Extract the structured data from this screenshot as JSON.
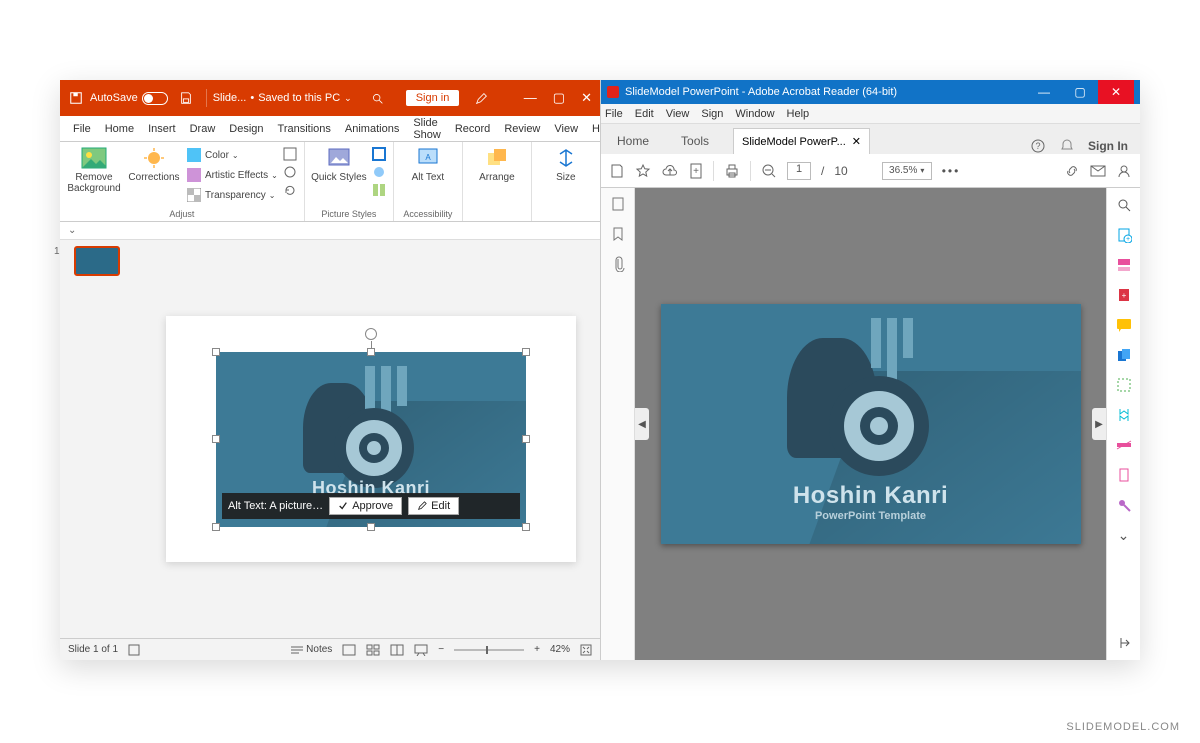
{
  "watermark": "SLIDEMODEL.COM",
  "powerpoint": {
    "titlebar": {
      "autosave_label": "AutoSave",
      "filename": "Slide...",
      "save_state": "Saved to this PC",
      "signin": "Sign in"
    },
    "tabs": [
      "File",
      "Home",
      "Insert",
      "Draw",
      "Design",
      "Transitions",
      "Animations",
      "Slide Show",
      "Record",
      "Review",
      "View",
      "Help"
    ],
    "ribbon": {
      "remove_bg": "Remove Background",
      "corrections": "Corrections",
      "color": "Color",
      "artistic": "Artistic Effects",
      "transparency": "Transparency",
      "adjust_label": "Adjust",
      "quick_styles": "Quick Styles",
      "picture_styles_label": "Picture Styles",
      "alt_text": "Alt Text",
      "accessibility_label": "Accessibility",
      "arrange": "Arrange",
      "size": "Size"
    },
    "thumb_number": "1",
    "slide": {
      "title": "Hoshin Kanri",
      "subtitle": "PowerPoint"
    },
    "alt_popup": {
      "text": "Alt Text: A picture…",
      "approve": "Approve",
      "edit": "Edit"
    },
    "status": {
      "slide_count": "Slide 1 of 1",
      "notes": "Notes",
      "zoom": "42%"
    }
  },
  "acrobat": {
    "titlebar": "SlideModel PowerPoint - Adobe Acrobat Reader (64-bit)",
    "menu": [
      "File",
      "Edit",
      "View",
      "Sign",
      "Window",
      "Help"
    ],
    "tabs": {
      "home": "Home",
      "tools": "Tools",
      "doc": "SlideModel PowerP...",
      "signin": "Sign In"
    },
    "toolbar": {
      "page_current": "1",
      "page_total": "10",
      "page_sep": "/",
      "zoom": "36.5%"
    },
    "page": {
      "title": "Hoshin Kanri",
      "subtitle": "PowerPoint Template"
    }
  }
}
